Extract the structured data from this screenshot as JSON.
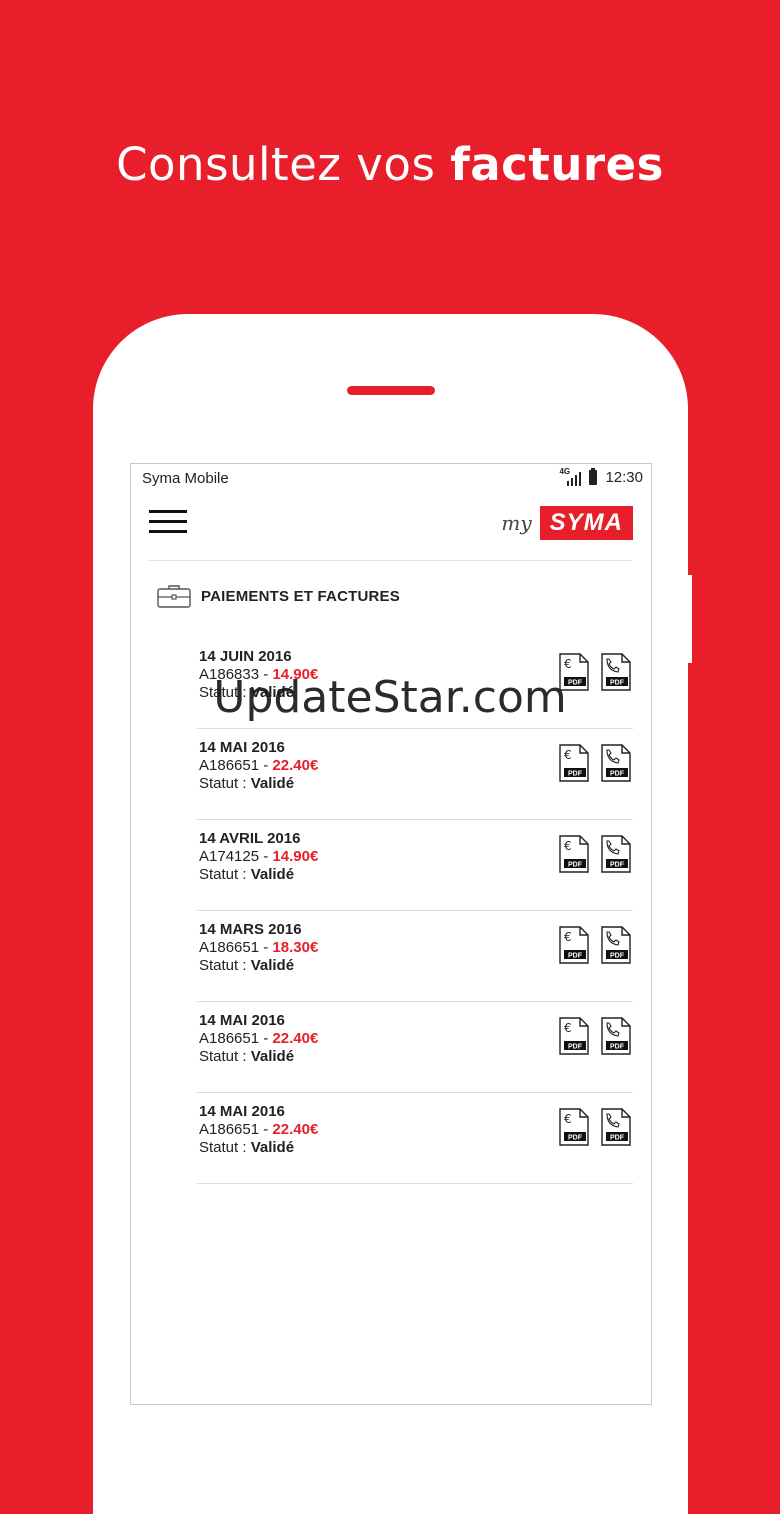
{
  "headline": {
    "regular": "Consultez vos ",
    "bold": "factures"
  },
  "status_bar": {
    "carrier": "Syma Mobile",
    "network": "4G",
    "time": "12:30"
  },
  "app_bar": {
    "logo_my": "my",
    "logo_brand": "SYMA"
  },
  "section": {
    "title": "PAIEMENTS ET FACTURES"
  },
  "invoices": [
    {
      "date": "14 JUIN 2016",
      "ref": "A186833",
      "sep": " - ",
      "amount": "14.90€",
      "status_label": "Statut : ",
      "status": "Validé"
    },
    {
      "date": "14 MAI 2016",
      "ref": "A186651",
      "sep": " - ",
      "amount": "22.40€",
      "status_label": "Statut : ",
      "status": "Validé"
    },
    {
      "date": "14 AVRIL 2016",
      "ref": "A174125",
      "sep": " - ",
      "amount": "14.90€",
      "status_label": "Statut : ",
      "status": "Validé"
    },
    {
      "date": "14 MARS 2016",
      "ref": "A186651",
      "sep": " - ",
      "amount": "18.30€",
      "status_label": "Statut : ",
      "status": "Validé"
    },
    {
      "date": "14 MAI 2016",
      "ref": "A186651",
      "sep": " - ",
      "amount": "22.40€",
      "status_label": "Statut : ",
      "status": "Validé"
    },
    {
      "date": "14 MAI 2016",
      "ref": "A186651",
      "sep": " - ",
      "amount": "22.40€",
      "status_label": "Statut : ",
      "status": "Validé"
    }
  ],
  "icons": {
    "invoice_pdf": "euro-pdf-icon",
    "call_detail_pdf": "phone-pdf-icon",
    "pdf_label": "PDF"
  },
  "watermark": "UpdateStar.com",
  "colors": {
    "brand_red": "#e81e2a",
    "text": "#222222"
  }
}
